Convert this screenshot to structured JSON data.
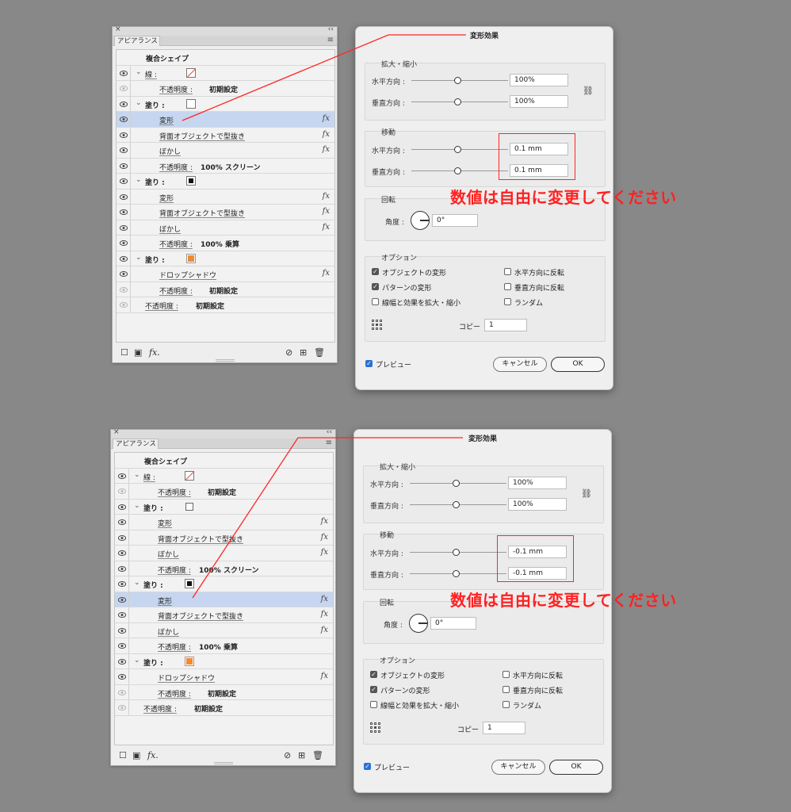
{
  "panel": {
    "close": "×",
    "collapse": "‹‹",
    "tab": "アピアランス",
    "menu": "≡",
    "object_type": "複合シェイプ",
    "footer_fx": "fx."
  },
  "labels": {
    "stroke": "線 :",
    "fill": "塗り :",
    "opacity": "不透明度 :",
    "transform": "変形",
    "knockout": "背面オブジェクトで型抜き",
    "blur": "ぼかし",
    "drop_shadow": "ドロップシャドウ",
    "default_value": "初期設定",
    "screen_value": "100% スクリーン",
    "multiply_value": "100% 乗算",
    "fx": "fx"
  },
  "dialog": {
    "title": "変形効果",
    "scale_group": "拡大・縮小",
    "move_group": "移動",
    "rotate_group": "回転",
    "options_group": "オプション",
    "horizontal": "水平方向 :",
    "vertical": "垂直方向 :",
    "angle": "角度 :",
    "scale_h": "100%",
    "scale_v": "100%",
    "angle_value": "0°",
    "opt_transform_objects": "オブジェクトの変形",
    "opt_transform_patterns": "パターンの変形",
    "opt_scale_strokes": "線幅と効果を拡大・縮小",
    "opt_reflect_x": "水平方向に反転",
    "opt_reflect_y": "垂直方向に反転",
    "opt_random": "ランダム",
    "copies_label": "コピー",
    "copies_value": "1",
    "preview": "プレビュー",
    "cancel": "キャンセル",
    "ok": "OK"
  },
  "sets": [
    {
      "move_h": "0.1 mm",
      "move_v": "0.1 mm"
    },
    {
      "move_h": "-0.1 mm",
      "move_v": "-0.1 mm"
    }
  ],
  "annotation": "数値は自由に変更してください",
  "colors": {
    "annotation_red": "#ff2121",
    "selection_blue": "#c6d6f0",
    "orange_fill": "#f08a33"
  }
}
